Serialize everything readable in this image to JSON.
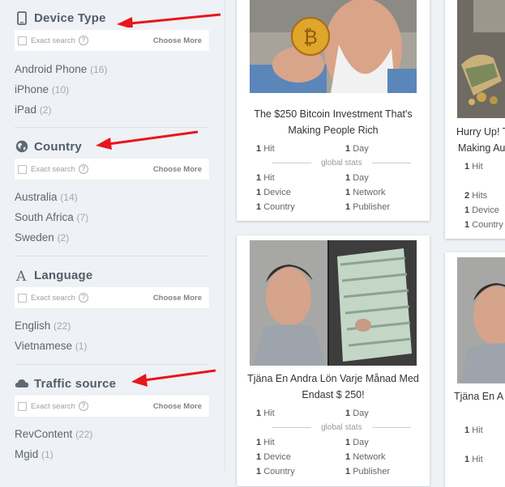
{
  "filters": {
    "device": {
      "title": "Device Type",
      "exact_label": "Exact search",
      "help": "?",
      "choose_more": "Choose More",
      "options": [
        {
          "label": "Android Phone",
          "count": "(16)"
        },
        {
          "label": "iPhone",
          "count": "(10)"
        },
        {
          "label": "iPad",
          "count": "(2)"
        }
      ]
    },
    "country": {
      "title": "Country",
      "exact_label": "Exact search",
      "help": "?",
      "choose_more": "Choose More",
      "options": [
        {
          "label": "Australia",
          "count": "(14)"
        },
        {
          "label": "South Africa",
          "count": "(7)"
        },
        {
          "label": "Sweden",
          "count": "(2)"
        }
      ]
    },
    "language": {
      "title": "Language",
      "exact_label": "Exact search",
      "help": "?",
      "choose_more": "Choose More",
      "options": [
        {
          "label": "English",
          "count": "(22)"
        },
        {
          "label": "Vietnamese",
          "count": "(1)"
        }
      ]
    },
    "traffic": {
      "title": "Traffic source",
      "exact_label": "Exact search",
      "help": "?",
      "choose_more": "Choose More",
      "options": [
        {
          "label": "RevContent",
          "count": "(22)"
        },
        {
          "label": "Mgid",
          "count": "(1)"
        }
      ]
    }
  },
  "cards": [
    {
      "title_line1": "The $250 Bitcoin Investment That's",
      "title_line2": "Making People Rich",
      "hits": "1",
      "hits_label": "Hit",
      "days": "1",
      "days_label": "Day",
      "global_stats": "global stats",
      "g_hits": "1",
      "g_hits_label": "Hit",
      "g_days": "1",
      "g_days_label": "Day",
      "devices": "1",
      "devices_label": "Device",
      "networks": "1",
      "networks_label": "Network",
      "countries": "1",
      "countries_label": "Country",
      "publishers": "1",
      "publishers_label": "Publisher"
    },
    {
      "title_line1": "Hurry Up! T",
      "title_line2": "Making Au",
      "hits": "1",
      "hits_label": "Hit",
      "g_hits": "2",
      "g_hits_label": "Hits",
      "devices": "1",
      "devices_label": "Device",
      "countries": "1",
      "countries_label": "Country"
    },
    {
      "title_line1": "Tjäna En Andra Lön Varje Månad Med",
      "title_line2": "Endast $ 250!",
      "hits": "1",
      "hits_label": "Hit",
      "days": "1",
      "days_label": "Day",
      "global_stats": "global stats",
      "g_hits": "1",
      "g_hits_label": "Hit",
      "g_days": "1",
      "g_days_label": "Day",
      "devices": "1",
      "devices_label": "Device",
      "networks": "1",
      "networks_label": "Network",
      "countries": "1",
      "countries_label": "Country",
      "publishers": "1",
      "publishers_label": "Publisher"
    },
    {
      "title_line1": "Tjäna En A",
      "hits": "1",
      "hits_label": "Hit",
      "g_hits": "1",
      "g_hits_label": "Hit"
    }
  ],
  "colors": {
    "arrow": "#e8161b",
    "sidebar_bg": "#eef1f5"
  }
}
